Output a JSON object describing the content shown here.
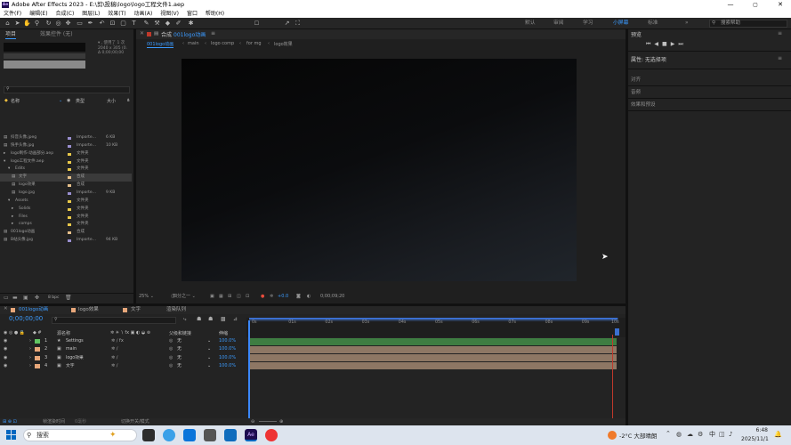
{
  "window": {
    "app_icon": "Ae",
    "title": "Adobe After Effects 2023 - E:\\剪\\投稿\\logo\\logo工程文件1.aep",
    "controls": [
      "—",
      "▢",
      "✕"
    ]
  },
  "menu": [
    "文件(F)",
    "编辑(E)",
    "合成(C)",
    "图层(L)",
    "效果(T)",
    "动画(A)",
    "视图(V)",
    "窗口",
    "帮助(H)"
  ],
  "toolbar": {
    "workspaces": [
      "默认",
      "审阅",
      "学习",
      "小屏幕",
      "标准"
    ],
    "active_workspace": "小屏幕",
    "search_help_placeholder": "搜索帮助"
  },
  "project_panel": {
    "tab_project": "项目",
    "tab_effect_controls": "效果控件 (无)",
    "info_lines": [
      "▾ , 使用了 1 次",
      "2040 x 305 (0.",
      "Δ 0;00;00;00"
    ],
    "col_name": "名称",
    "col_type": "类型",
    "col_size": "大小",
    "items": [
      {
        "name": "抖音头像.jpeg",
        "type": "Importe...",
        "size": "6 KB",
        "color": "#9a8fd0"
      },
      {
        "name": "快手头像.jpg",
        "type": "Importe...",
        "size": "10 KB",
        "color": "#9a8fd0"
      },
      {
        "name": "logo制作-动画部分.aep",
        "type": "文件夹",
        "size": "",
        "color": "#e8c84a"
      },
      {
        "name": "logo工程文件.aep",
        "type": "文件夹",
        "size": "",
        "color": "#e8c84a"
      },
      {
        "name": "Edits",
        "type": "文件夹",
        "size": "",
        "color": "#e8c84a"
      },
      {
        "name": "文字",
        "type": "合成",
        "size": "",
        "color": "#e6c08a"
      },
      {
        "name": "logo效果",
        "type": "合成",
        "size": "",
        "color": "#e6c08a"
      },
      {
        "name": "logo.jpg",
        "type": "Importe...",
        "size": "9 KB",
        "color": "#9a8fd0"
      },
      {
        "name": "Assets",
        "type": "文件夹",
        "size": "",
        "color": "#e8c84a"
      },
      {
        "name": "Solids",
        "type": "文件夹",
        "size": "",
        "color": "#e8c84a"
      },
      {
        "name": "Files",
        "type": "文件夹",
        "size": "",
        "color": "#e8c84a"
      },
      {
        "name": "comps",
        "type": "文件夹",
        "size": "",
        "color": "#e8c84a"
      },
      {
        "name": "001logo动画",
        "type": "合成",
        "size": "",
        "color": "#e6c08a"
      },
      {
        "name": "B站头像.jpg",
        "type": "Importe...",
        "size": "94 KB",
        "color": "#9a8fd0"
      }
    ],
    "footer_bpc": "8 bpc"
  },
  "composition_panel": {
    "tab_label": "合成",
    "comp_name": "001logo动画",
    "breadcrumbs": [
      "001logo动画",
      "main",
      "logo comp",
      "for mg",
      "logo效果"
    ],
    "magnification": "25%",
    "resolution": "四分之一",
    "exposure": "+0.0",
    "timecode": "0;00;09;20"
  },
  "right_panel": {
    "preview_title": "预览",
    "properties_title": "属性: 无选择项",
    "sections": [
      "对齐",
      "音频",
      "效果和预设"
    ]
  },
  "timeline": {
    "tabs": [
      "001logo动画",
      "logo效果",
      "文字",
      "渲染队列"
    ],
    "current_time": "0;00;00;00",
    "col_source_name": "源名称",
    "col_parent": "父级和链接",
    "col_stretch": "伸缩",
    "ruler": [
      "0s",
      "01s",
      "02s",
      "03s",
      "04s",
      "05s",
      "06s",
      "07s",
      "08s",
      "09s",
      "10s"
    ],
    "layers": [
      {
        "num": "1",
        "name": "Settings",
        "parent": "无",
        "stretch": "100.0%",
        "label_color": "#62c462",
        "bar_color": "#3e7d42"
      },
      {
        "num": "2",
        "name": "main",
        "parent": "无",
        "stretch": "100.0%",
        "label_color": "#e8a77a",
        "bar_color": "#8e7764"
      },
      {
        "num": "3",
        "name": "logo效果",
        "parent": "无",
        "stretch": "100.0%",
        "label_color": "#e8a77a",
        "bar_color": "#8e7764"
      },
      {
        "num": "4",
        "name": "文字",
        "parent": "无",
        "stretch": "100.0%",
        "label_color": "#e8a77a",
        "bar_color": "#8e7764"
      }
    ],
    "footer_left": "帧渲染时间",
    "footer_time": "0毫秒",
    "footer_toggle": "切换开关/模式"
  },
  "taskbar": {
    "search": "搜索",
    "weather": "-2°C 大部晴朗",
    "ime": "中",
    "time": "6:48",
    "date": "2025/11/1"
  }
}
